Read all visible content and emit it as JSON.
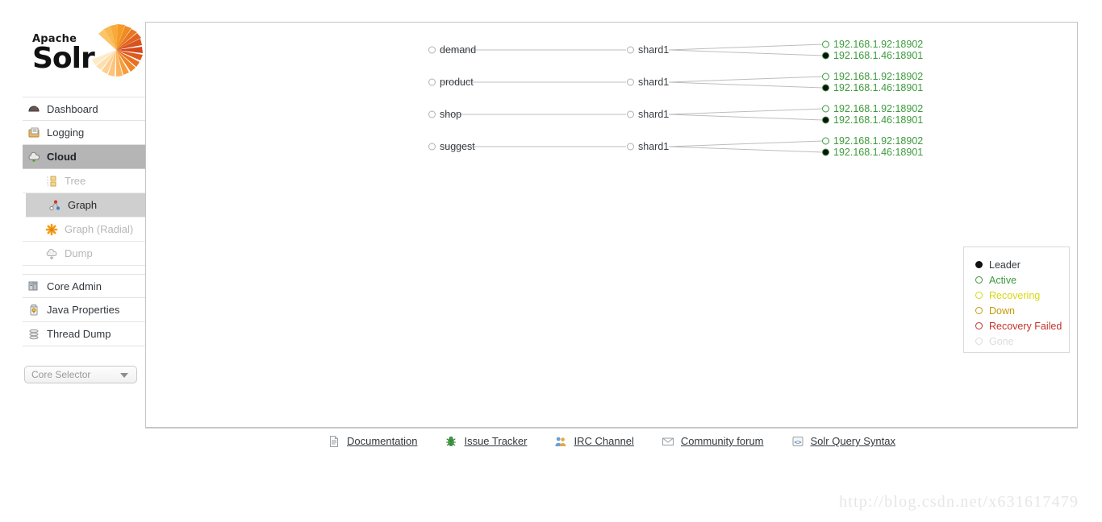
{
  "brand": {
    "apache": "Apache",
    "solr": "Solr",
    "burst_color": "#e8881f"
  },
  "sidebar": {
    "items": [
      {
        "label": "Dashboard",
        "icon": "dashboard-icon",
        "state": "normal"
      },
      {
        "label": "Logging",
        "icon": "logging-icon",
        "state": "normal"
      },
      {
        "label": "Cloud",
        "icon": "cloud-icon",
        "state": "active"
      }
    ],
    "sub_items": [
      {
        "label": "Tree",
        "icon": "tree-icon",
        "state": "dimmed"
      },
      {
        "label": "Graph",
        "icon": "graph-icon",
        "state": "selected"
      },
      {
        "label": "Graph (Radial)",
        "icon": "graph-radial-icon",
        "state": "dimmed"
      },
      {
        "label": "Dump",
        "icon": "dump-icon",
        "state": "dimmed"
      }
    ],
    "items_lower": [
      {
        "label": "Core Admin",
        "icon": "core-admin-icon",
        "state": "normal"
      },
      {
        "label": "Java Properties",
        "icon": "java-properties-icon",
        "state": "normal"
      },
      {
        "label": "Thread Dump",
        "icon": "thread-dump-icon",
        "state": "normal"
      }
    ],
    "core_selector": {
      "placeholder": "Core Selector",
      "icon": "chevron-down-icon"
    }
  },
  "graph": {
    "rows": [
      {
        "collection": "demand",
        "shard": "shard1",
        "replicas": [
          {
            "label": "192.168.1.92:18902",
            "status": "active",
            "leader": false
          },
          {
            "label": "192.168.1.46:18901",
            "status": "active",
            "leader": true
          }
        ]
      },
      {
        "collection": "product",
        "shard": "shard1",
        "replicas": [
          {
            "label": "192.168.1.92:18902",
            "status": "active",
            "leader": false
          },
          {
            "label": "192.168.1.46:18901",
            "status": "active",
            "leader": true
          }
        ]
      },
      {
        "collection": "shop",
        "shard": "shard1",
        "replicas": [
          {
            "label": "192.168.1.92:18902",
            "status": "active",
            "leader": false
          },
          {
            "label": "192.168.1.46:18901",
            "status": "active",
            "leader": true
          }
        ]
      },
      {
        "collection": "suggest",
        "shard": "shard1",
        "replicas": [
          {
            "label": "192.168.1.92:18902",
            "status": "active",
            "leader": false
          },
          {
            "label": "192.168.1.46:18901",
            "status": "active",
            "leader": true
          }
        ]
      }
    ]
  },
  "legend": {
    "entries": [
      {
        "label": "Leader",
        "color": "#111111",
        "filled": true
      },
      {
        "label": "Active",
        "color": "#3c9a3c",
        "filled": false
      },
      {
        "label": "Recovering",
        "color": "#d8d814",
        "filled": false
      },
      {
        "label": "Down",
        "color": "#c79a0a",
        "filled": false
      },
      {
        "label": "Recovery Failed",
        "color": "#c4342b",
        "filled": false
      },
      {
        "label": "Gone",
        "color": "#dcdcdc",
        "filled": false
      }
    ]
  },
  "footer": {
    "links": [
      {
        "label": "Documentation",
        "icon": "document-icon"
      },
      {
        "label": "Issue Tracker",
        "icon": "bug-icon"
      },
      {
        "label": "IRC Channel",
        "icon": "people-icon"
      },
      {
        "label": "Community forum",
        "icon": "envelope-icon"
      },
      {
        "label": "Solr Query Syntax",
        "icon": "code-icon"
      }
    ]
  },
  "watermark": {
    "text": "http://blog.csdn.net/x631617479"
  }
}
